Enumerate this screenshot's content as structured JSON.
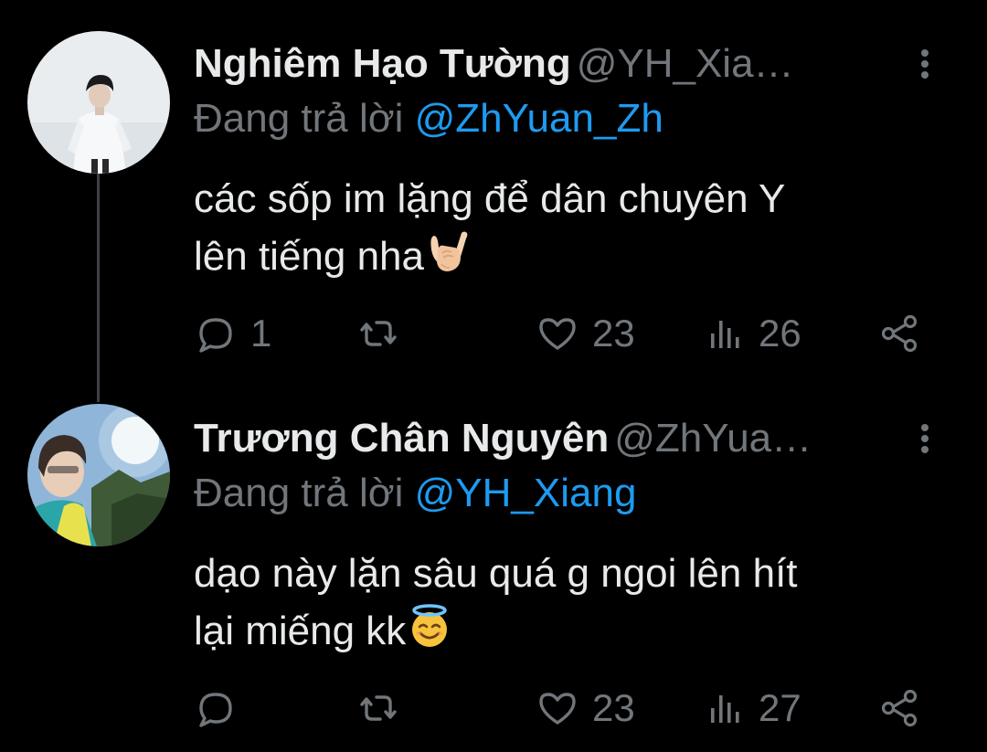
{
  "colors": {
    "background": "#000000",
    "primary_text": "#e7e9ea",
    "secondary_text": "#71767b",
    "mention": "#1d9bf0",
    "thread_line": "#3d4145"
  },
  "tweets": [
    {
      "display_name": "Nghiêm Hạo Tường",
      "handle": "@YH_Xia…",
      "reply_prefix": "Đang trả lời",
      "reply_to": "@ZhYuan_Zh",
      "text_line1": "các sốp im lặng để dân chuyên Y",
      "text_line2": "lên tiếng nha",
      "emoji": "sign-of-horns-emoji",
      "stats": {
        "replies": "1",
        "retweets": "",
        "likes": "23",
        "views": "26"
      }
    },
    {
      "display_name": "Trương Chân Nguyên",
      "handle": "@ZhYua…",
      "reply_prefix": "Đang trả lời",
      "reply_to": "@YH_Xiang",
      "text_line1": "dạo này lặn sâu quá g ngoi lên hít",
      "text_line2": "lại miếng kk",
      "emoji": "smiling-face-with-halo-emoji",
      "stats": {
        "replies": "",
        "retweets": "",
        "likes": "23",
        "views": "27"
      }
    }
  ]
}
